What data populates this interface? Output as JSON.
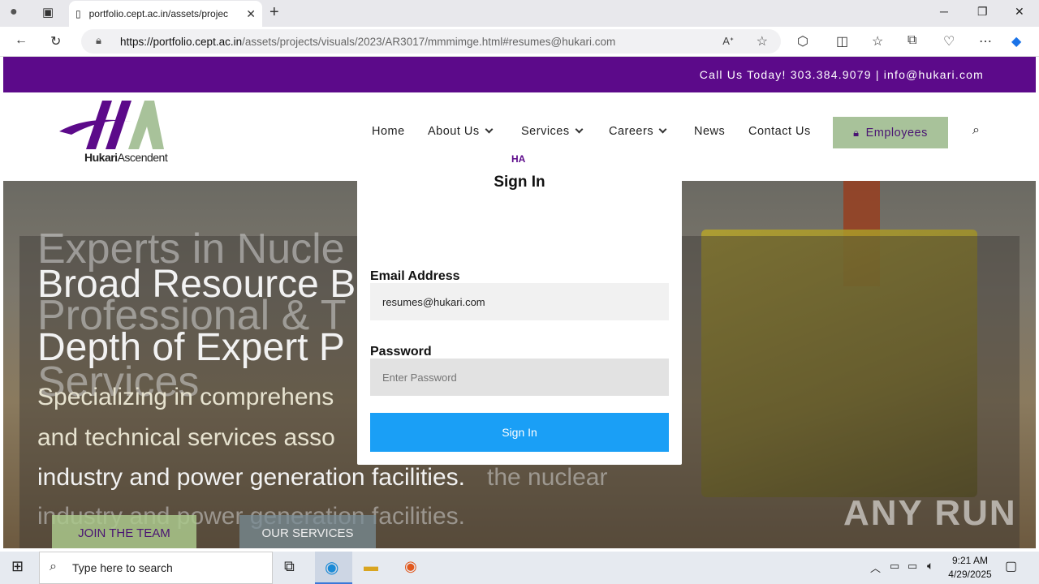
{
  "browser": {
    "tab_title": "portfolio.cept.ac.in/assets/projec",
    "url_host": "https://portfolio.cept.ac.in",
    "url_path": "/assets/projects/visuals/2023/AR3017/mmmimge.html#resumes@hukari.com"
  },
  "site": {
    "topbar_text": "Call Us Today!  303.384.9079 | info@hukari.com",
    "logo_name_bold": "Hukari",
    "logo_name_rest": "Ascendent",
    "nav": {
      "home": "Home",
      "about": "About Us",
      "services": "Services",
      "careers": "Careers",
      "news": "News",
      "contact": "Contact Us",
      "employees": "Employees"
    },
    "hero": {
      "ghost_line1": "Experts in Nucle",
      "headline1": "Broad Resource B",
      "ghost_line2": "Professional & T",
      "headline2": "Depth of Expert P",
      "ghost_line3": "Services",
      "sub1": "Specializing in comprehens",
      "sub2": "and technical services asso",
      "sub3": "industry and power generation facilities.",
      "sub3_ghost": "the nuclear",
      "ghost_line4": "industry and power generation facilities.",
      "join_button": "JOIN THE TEAM",
      "services_button": "OUR SERVICES"
    },
    "watermark": "ANY RUN"
  },
  "modal": {
    "title": "Sign In",
    "email_label": "Email Address",
    "email_value": "resumes@hukari.com",
    "password_label": "Password",
    "password_placeholder": "Enter Password",
    "signin_button": "Sign In"
  },
  "taskbar": {
    "search_placeholder": "Type here to search",
    "time": "9:21 AM",
    "date": "4/29/2025"
  }
}
